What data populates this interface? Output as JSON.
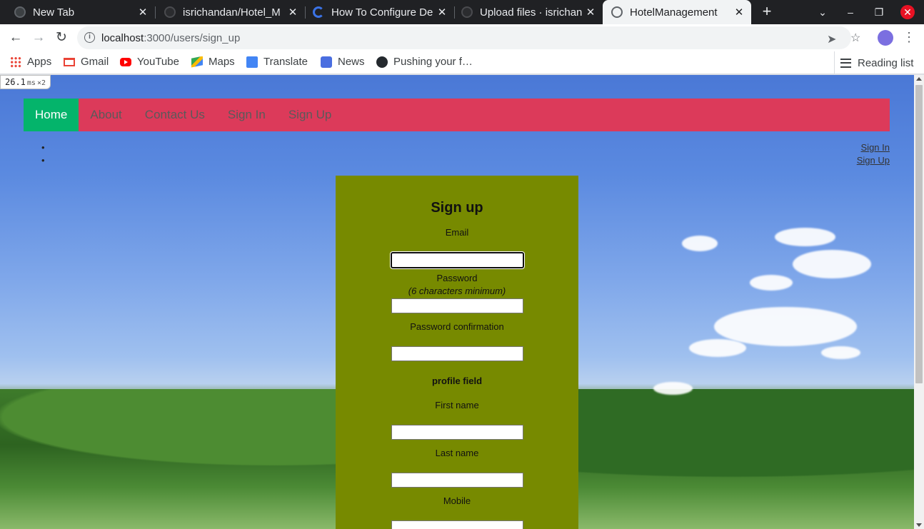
{
  "browser": {
    "tabs": [
      {
        "title": "New Tab",
        "icon": "chrome-icon",
        "active": false
      },
      {
        "title": "isrichandan/Hotel_M",
        "icon": "github-icon",
        "active": false
      },
      {
        "title": "How To Configure De",
        "icon": "digitalocean-icon",
        "active": false
      },
      {
        "title": "Upload files · isrichan",
        "icon": "github-icon",
        "active": false
      },
      {
        "title": "HotelManagement",
        "icon": "globe-icon",
        "active": true
      }
    ],
    "close_glyph": "✕",
    "new_tab_glyph": "+",
    "url_host": "localhost",
    "url_path": ":3000/users/sign_up",
    "bookmarks": [
      "Apps",
      "Gmail",
      "YouTube",
      "Maps",
      "Translate",
      "News",
      "Pushing your f…"
    ],
    "reading_list": "Reading list"
  },
  "perf": {
    "value": "26.1",
    "unit": "ms",
    "multiplier": "×2"
  },
  "site": {
    "nav": [
      {
        "label": "Home",
        "active": true
      },
      {
        "label": "About",
        "active": false
      },
      {
        "label": "Contact Us",
        "active": false
      },
      {
        "label": "Sign In",
        "active": false
      },
      {
        "label": "Sign Up",
        "active": false
      }
    ],
    "right_links": {
      "sign_in": "Sign In",
      "sign_up": "Sign Up"
    },
    "bullet": "•"
  },
  "form": {
    "heading": "Sign up",
    "email_label": "Email",
    "password_label": "Password",
    "password_hint": "(6 characters minimum)",
    "password_confirmation_label": "Password confirmation",
    "profile_section": "profile field",
    "first_name_label": "First name",
    "last_name_label": "Last name",
    "mobile_label": "Mobile"
  },
  "colors": {
    "navbar": "#dc3a5a",
    "nav_active": "#04b46b",
    "form_card": "#778a00"
  }
}
